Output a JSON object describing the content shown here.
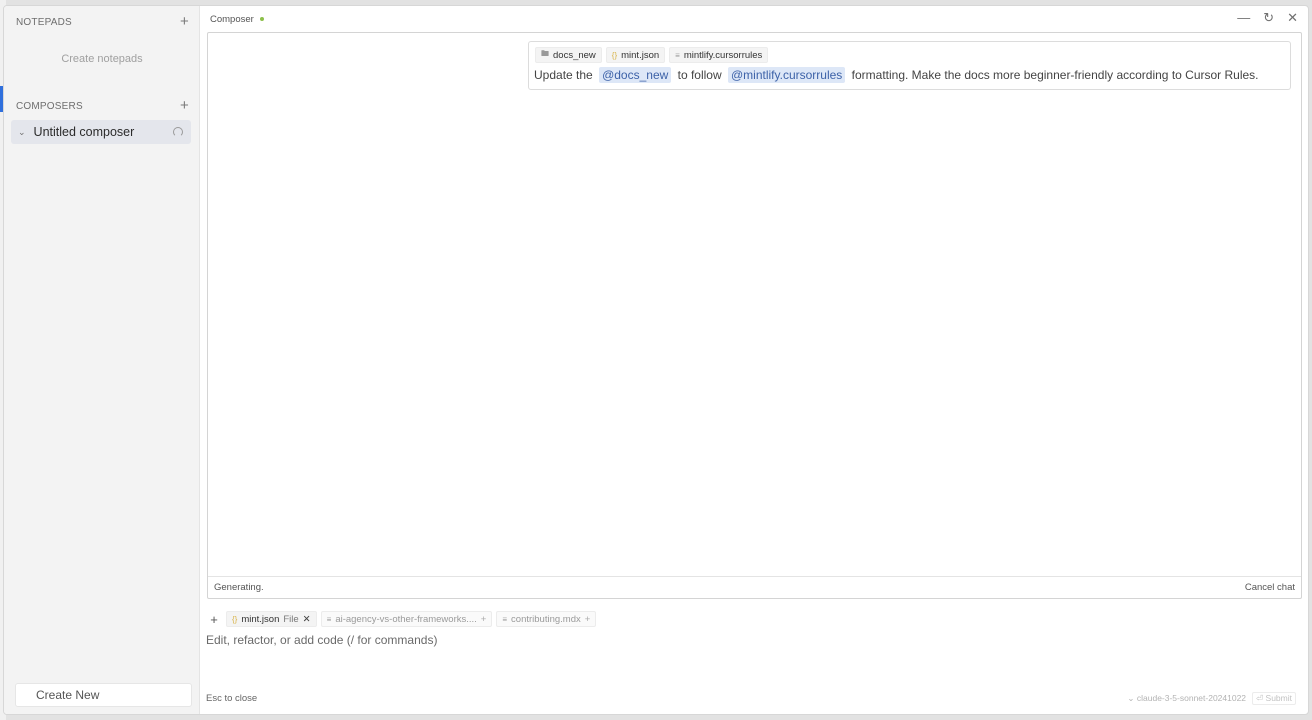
{
  "sidebar": {
    "notepads_heading": "NOTEPADS",
    "notepads_empty": "Create notepads",
    "composers_heading": "COMPOSERS",
    "composers": [
      {
        "label": "Untitled composer"
      }
    ],
    "create_new": "Create New"
  },
  "titlebar": {
    "title": "Composer"
  },
  "message": {
    "chips": [
      "docs_new",
      "mint.json",
      "mintlify.cursorrules"
    ],
    "text_before": "Update the",
    "mention1": "@docs_new",
    "text_middle": "to follow",
    "mention2": "@mintlify.cursorrules",
    "text_after": "formatting. Make the docs more beginner-friendly according to Cursor Rules."
  },
  "status": {
    "generating": "Generating.",
    "cancel": "Cancel chat"
  },
  "context": {
    "chips": [
      {
        "label": "mint.json",
        "tag": "File"
      },
      {
        "label": "ai-agency-vs-other-frameworks...."
      },
      {
        "label": "contributing.mdx"
      }
    ]
  },
  "input": {
    "placeholder": "Edit, refactor, or add code (/ for commands)"
  },
  "footer": {
    "esc": "Esc to close",
    "model": "claude-3-5-sonnet-20241022",
    "submit": "⏎ Submit"
  },
  "colors": {
    "accent": "#2f6fdc",
    "status_dot": "#8cc04a",
    "mention_bg": "#dde7f7"
  }
}
